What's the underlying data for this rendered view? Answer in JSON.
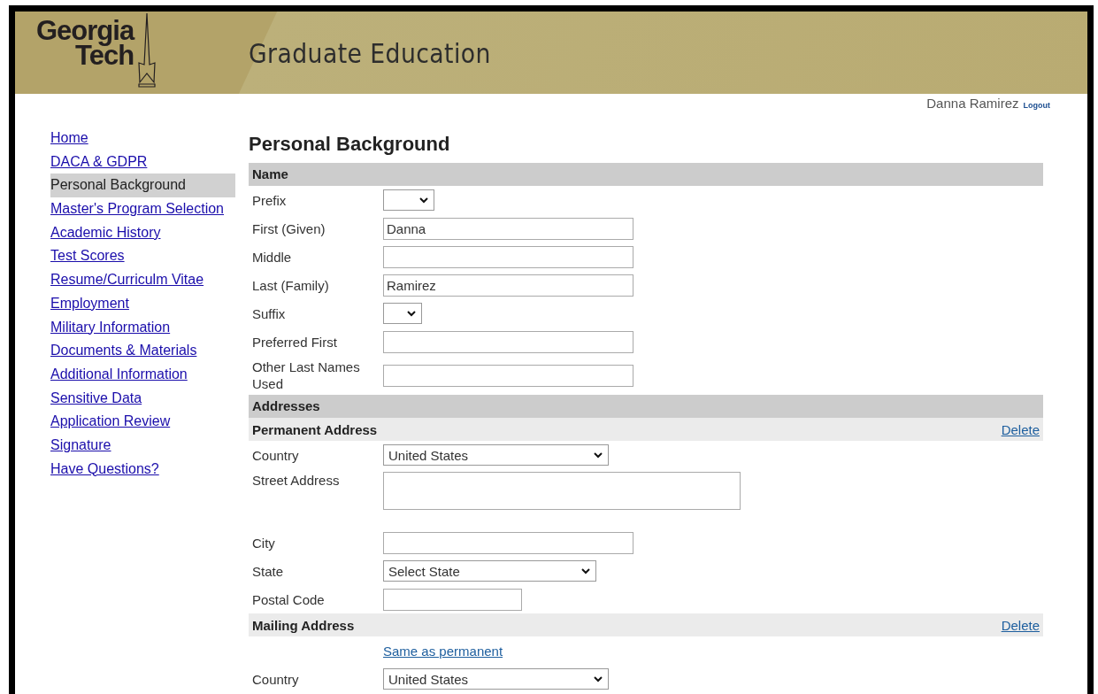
{
  "header": {
    "logo_line_1": "Georgia",
    "logo_line_2": "Tech",
    "title": "Graduate Education"
  },
  "user": {
    "name": "Danna Ramirez",
    "logout": "Logout"
  },
  "sidebar": {
    "items": [
      {
        "label": "Home",
        "selected": false
      },
      {
        "label": "DACA & GDPR",
        "selected": false
      },
      {
        "label": "Personal Background",
        "selected": true
      },
      {
        "label": "Master's Program Selection",
        "selected": false
      },
      {
        "label": "Academic History",
        "selected": false
      },
      {
        "label": "Test Scores",
        "selected": false
      },
      {
        "label": "Resume/Curriculm Vitae",
        "selected": false
      },
      {
        "label": "Employment",
        "selected": false
      },
      {
        "label": "Military Information",
        "selected": false
      },
      {
        "label": "Documents & Materials",
        "selected": false
      },
      {
        "label": "Additional Information",
        "selected": false
      },
      {
        "label": "Sensitive Data",
        "selected": false
      },
      {
        "label": "Application Review",
        "selected": false
      },
      {
        "label": "Signature",
        "selected": false
      },
      {
        "label": "Have Questions?",
        "selected": false
      }
    ]
  },
  "page_title": "Personal Background",
  "rows": [
    {
      "kind": "section",
      "label": "Name"
    },
    {
      "kind": "select-narrow",
      "label": "Prefix"
    },
    {
      "kind": "text",
      "label": "First (Given)",
      "value": "Danna"
    },
    {
      "kind": "text",
      "label": "Middle"
    },
    {
      "kind": "text",
      "label": "Last (Family)",
      "value": "Ramirez"
    },
    {
      "kind": "select-tiny",
      "label": "Suffix"
    },
    {
      "kind": "text",
      "label": "Preferred First"
    },
    {
      "kind": "text",
      "label": "Other Last Names Used"
    },
    {
      "kind": "section",
      "label": "Addresses"
    },
    {
      "kind": "subsection",
      "label": "Permanent Address",
      "action": "Delete"
    },
    {
      "kind": "select-wide",
      "label": "Country",
      "value": "United States"
    },
    {
      "kind": "textarea",
      "label": "Street Address"
    },
    {
      "kind": "text",
      "label": "City"
    },
    {
      "kind": "select-medium",
      "label": "State",
      "value": "Select State"
    },
    {
      "kind": "text-short",
      "label": "Postal Code"
    },
    {
      "kind": "subsection",
      "label": "Mailing Address",
      "action": "Delete"
    },
    {
      "kind": "link",
      "label": "Same as permanent"
    },
    {
      "kind": "select-wide",
      "label": "Country",
      "value": "United States"
    }
  ]
}
